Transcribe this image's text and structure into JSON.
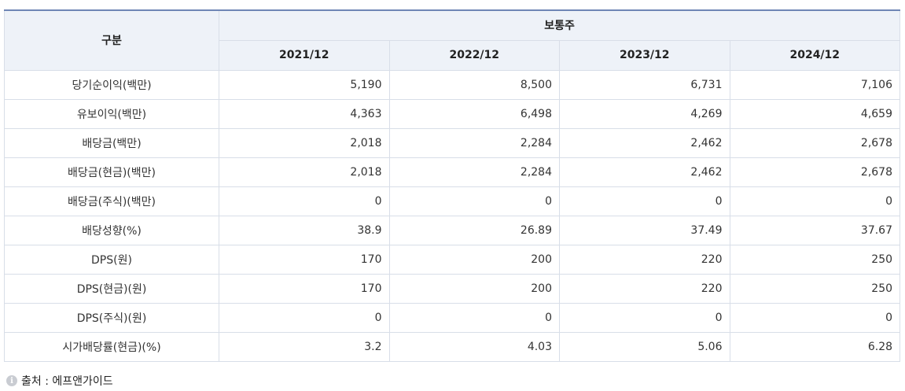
{
  "table": {
    "corner_label": "구분",
    "group_label": "보통주",
    "periods": [
      "2021/12",
      "2022/12",
      "2023/12",
      "2024/12"
    ],
    "rows": [
      {
        "label": "당기순이익(백만)",
        "values": [
          "5,190",
          "8,500",
          "6,731",
          "7,106"
        ]
      },
      {
        "label": "유보이익(백만)",
        "values": [
          "4,363",
          "6,498",
          "4,269",
          "4,659"
        ]
      },
      {
        "label": "배당금(백만)",
        "values": [
          "2,018",
          "2,284",
          "2,462",
          "2,678"
        ]
      },
      {
        "label": "배당금(현금)(백만)",
        "values": [
          "2,018",
          "2,284",
          "2,462",
          "2,678"
        ]
      },
      {
        "label": "배당금(주식)(백만)",
        "values": [
          "0",
          "0",
          "0",
          "0"
        ]
      },
      {
        "label": "배당성향(%)",
        "values": [
          "38.9",
          "26.89",
          "37.49",
          "37.67"
        ]
      },
      {
        "label": "DPS(원)",
        "values": [
          "170",
          "200",
          "220",
          "250"
        ]
      },
      {
        "label": "DPS(현금)(원)",
        "values": [
          "170",
          "200",
          "220",
          "250"
        ]
      },
      {
        "label": "DPS(주식)(원)",
        "values": [
          "0",
          "0",
          "0",
          "0"
        ]
      },
      {
        "label": "시가배당률(현금)(%)",
        "values": [
          "3.2",
          "4.03",
          "5.06",
          "6.28"
        ]
      }
    ]
  },
  "footer": {
    "icon": "info-icon",
    "source_text": "출처 : 에프앤가이드"
  }
}
